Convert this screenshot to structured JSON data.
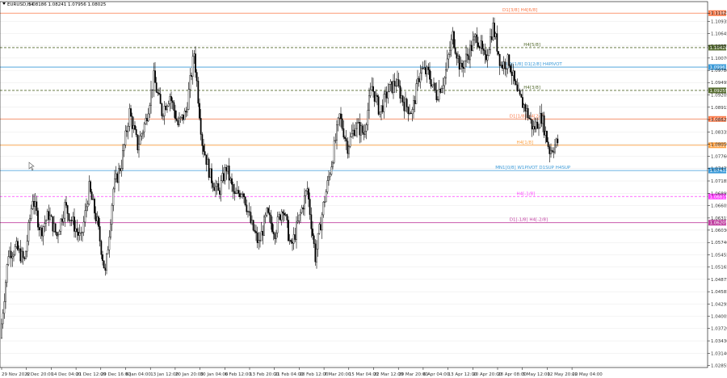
{
  "header": {
    "symbol": "EURUSD,H4",
    "ohlc": "1.08186 1.08241 1.07956 1.08025",
    "menu_icon": "triangle-down-icon"
  },
  "colors": {
    "candles": "#000000",
    "grid": "#e8e8e8"
  },
  "chart_data": {
    "type": "candlestick",
    "ylim": [
      1.02805,
      1.11395
    ],
    "y_ticks": [
      "1.11125",
      "1.10935",
      "1.10645",
      "1.10355",
      "1.10070",
      "1.09780",
      "1.09495",
      "1.09205",
      "1.08915",
      "1.08625",
      "1.08335",
      "1.08050",
      "1.07760",
      "1.07475",
      "1.07185",
      "1.06895",
      "1.06605",
      "1.06315",
      "1.06030",
      "1.05740",
      "1.05455",
      "1.05165",
      "1.04875",
      "1.04585",
      "1.04295",
      "1.04005",
      "1.03720",
      "1.03430",
      "1.03140",
      "1.02855"
    ],
    "x_ticks": [
      "29 Nov 2022",
      "6 Dec 20:00",
      "14 Dec 04:00",
      "21 Dec 12:00",
      "29 Dec 16:00",
      "6 Jan 04:00",
      "13 Jan 12:00",
      "20 Jan 20:00",
      "30 Jan 04:00",
      "6 Feb 12:00",
      "13 Feb 20:00",
      "21 Feb 04:00",
      "28 Feb 12:00",
      "7 Mar 20:00",
      "15 Mar 04:00",
      "22 Mar 12:00",
      "29 Mar 20:00",
      "6 Apr 04:00",
      "13 Apr 12:00",
      "20 Apr 20:00",
      "28 Apr 08:00",
      "5 May 12:00",
      "12 May 20:00",
      "22 May 04:00"
    ],
    "price_path": [
      1.035,
      1.055,
      1.056,
      1.053,
      1.068,
      1.06,
      1.064,
      1.059,
      1.066,
      1.062,
      1.058,
      1.07,
      1.062,
      1.05,
      1.07,
      1.076,
      1.088,
      1.08,
      1.086,
      1.096,
      1.088,
      1.092,
      1.085,
      1.088,
      1.102,
      1.081,
      1.073,
      1.069,
      1.075,
      1.068,
      1.07,
      1.062,
      1.057,
      1.064,
      1.06,
      1.066,
      1.056,
      1.063,
      1.07,
      1.054,
      1.066,
      1.076,
      1.087,
      1.08,
      1.085,
      1.083,
      1.094,
      1.088,
      1.093,
      1.095,
      1.09,
      1.088,
      1.098,
      1.097,
      1.092,
      1.096,
      1.106,
      1.098,
      1.102,
      1.106,
      1.1,
      1.108,
      1.099,
      1.1,
      1.092,
      1.089,
      1.084,
      1.087,
      1.079,
      1.081
    ],
    "levels": [
      {
        "label": "D1[3/8] H4[6/8]",
        "price": 1.11125,
        "badge": "1.11064",
        "color": "#fa7a4a",
        "dash": "",
        "label_pos": 0.71
      },
      {
        "label": "H4[5/8]",
        "price": 1.10315,
        "badge": "1.10426",
        "color": "#556b2f",
        "dash": "3,2",
        "label_pos": 0.74
      },
      {
        "label": "MN1[1/8] D1[2/8] H4PIVOT",
        "price": 1.09858,
        "badge": "1.09963",
        "color": "#3a9ad9",
        "dash": "",
        "label_pos": 0.71
      },
      {
        "label": "H4[3/8]",
        "price": 1.0931,
        "badge": "1.09255",
        "color": "#556b2f",
        "dash": "3,2",
        "label_pos": 0.74
      },
      {
        "label": "D1[1/8] H4[2/8]",
        "price": 1.0864,
        "badge": "1.08643",
        "color": "#fa7a4a",
        "dash": "",
        "label_pos": 0.72
      },
      {
        "label": "H4[1/8]",
        "price": 1.08023,
        "badge": "1.08025",
        "color": "#ffa040",
        "dash": "",
        "label_pos": 0.73
      },
      {
        "label": "MN1[0/8] W1PIVOT D1SUP H4SUP",
        "price": 1.0743,
        "badge": "1.07433",
        "color": "#3a9ad9",
        "dash": "",
        "label_pos": 0.7
      },
      {
        "label": "H4[-1/8]",
        "price": 1.0682,
        "badge": "1.06815",
        "color": "#ff40ff",
        "dash": "3,2",
        "label_pos": 0.73
      },
      {
        "label": "D1[-1/8] H4[-2/8]",
        "price": 1.06205,
        "badge": "1.06205",
        "color": "#c040a0",
        "dash": "",
        "label_pos": 0.72
      }
    ]
  }
}
